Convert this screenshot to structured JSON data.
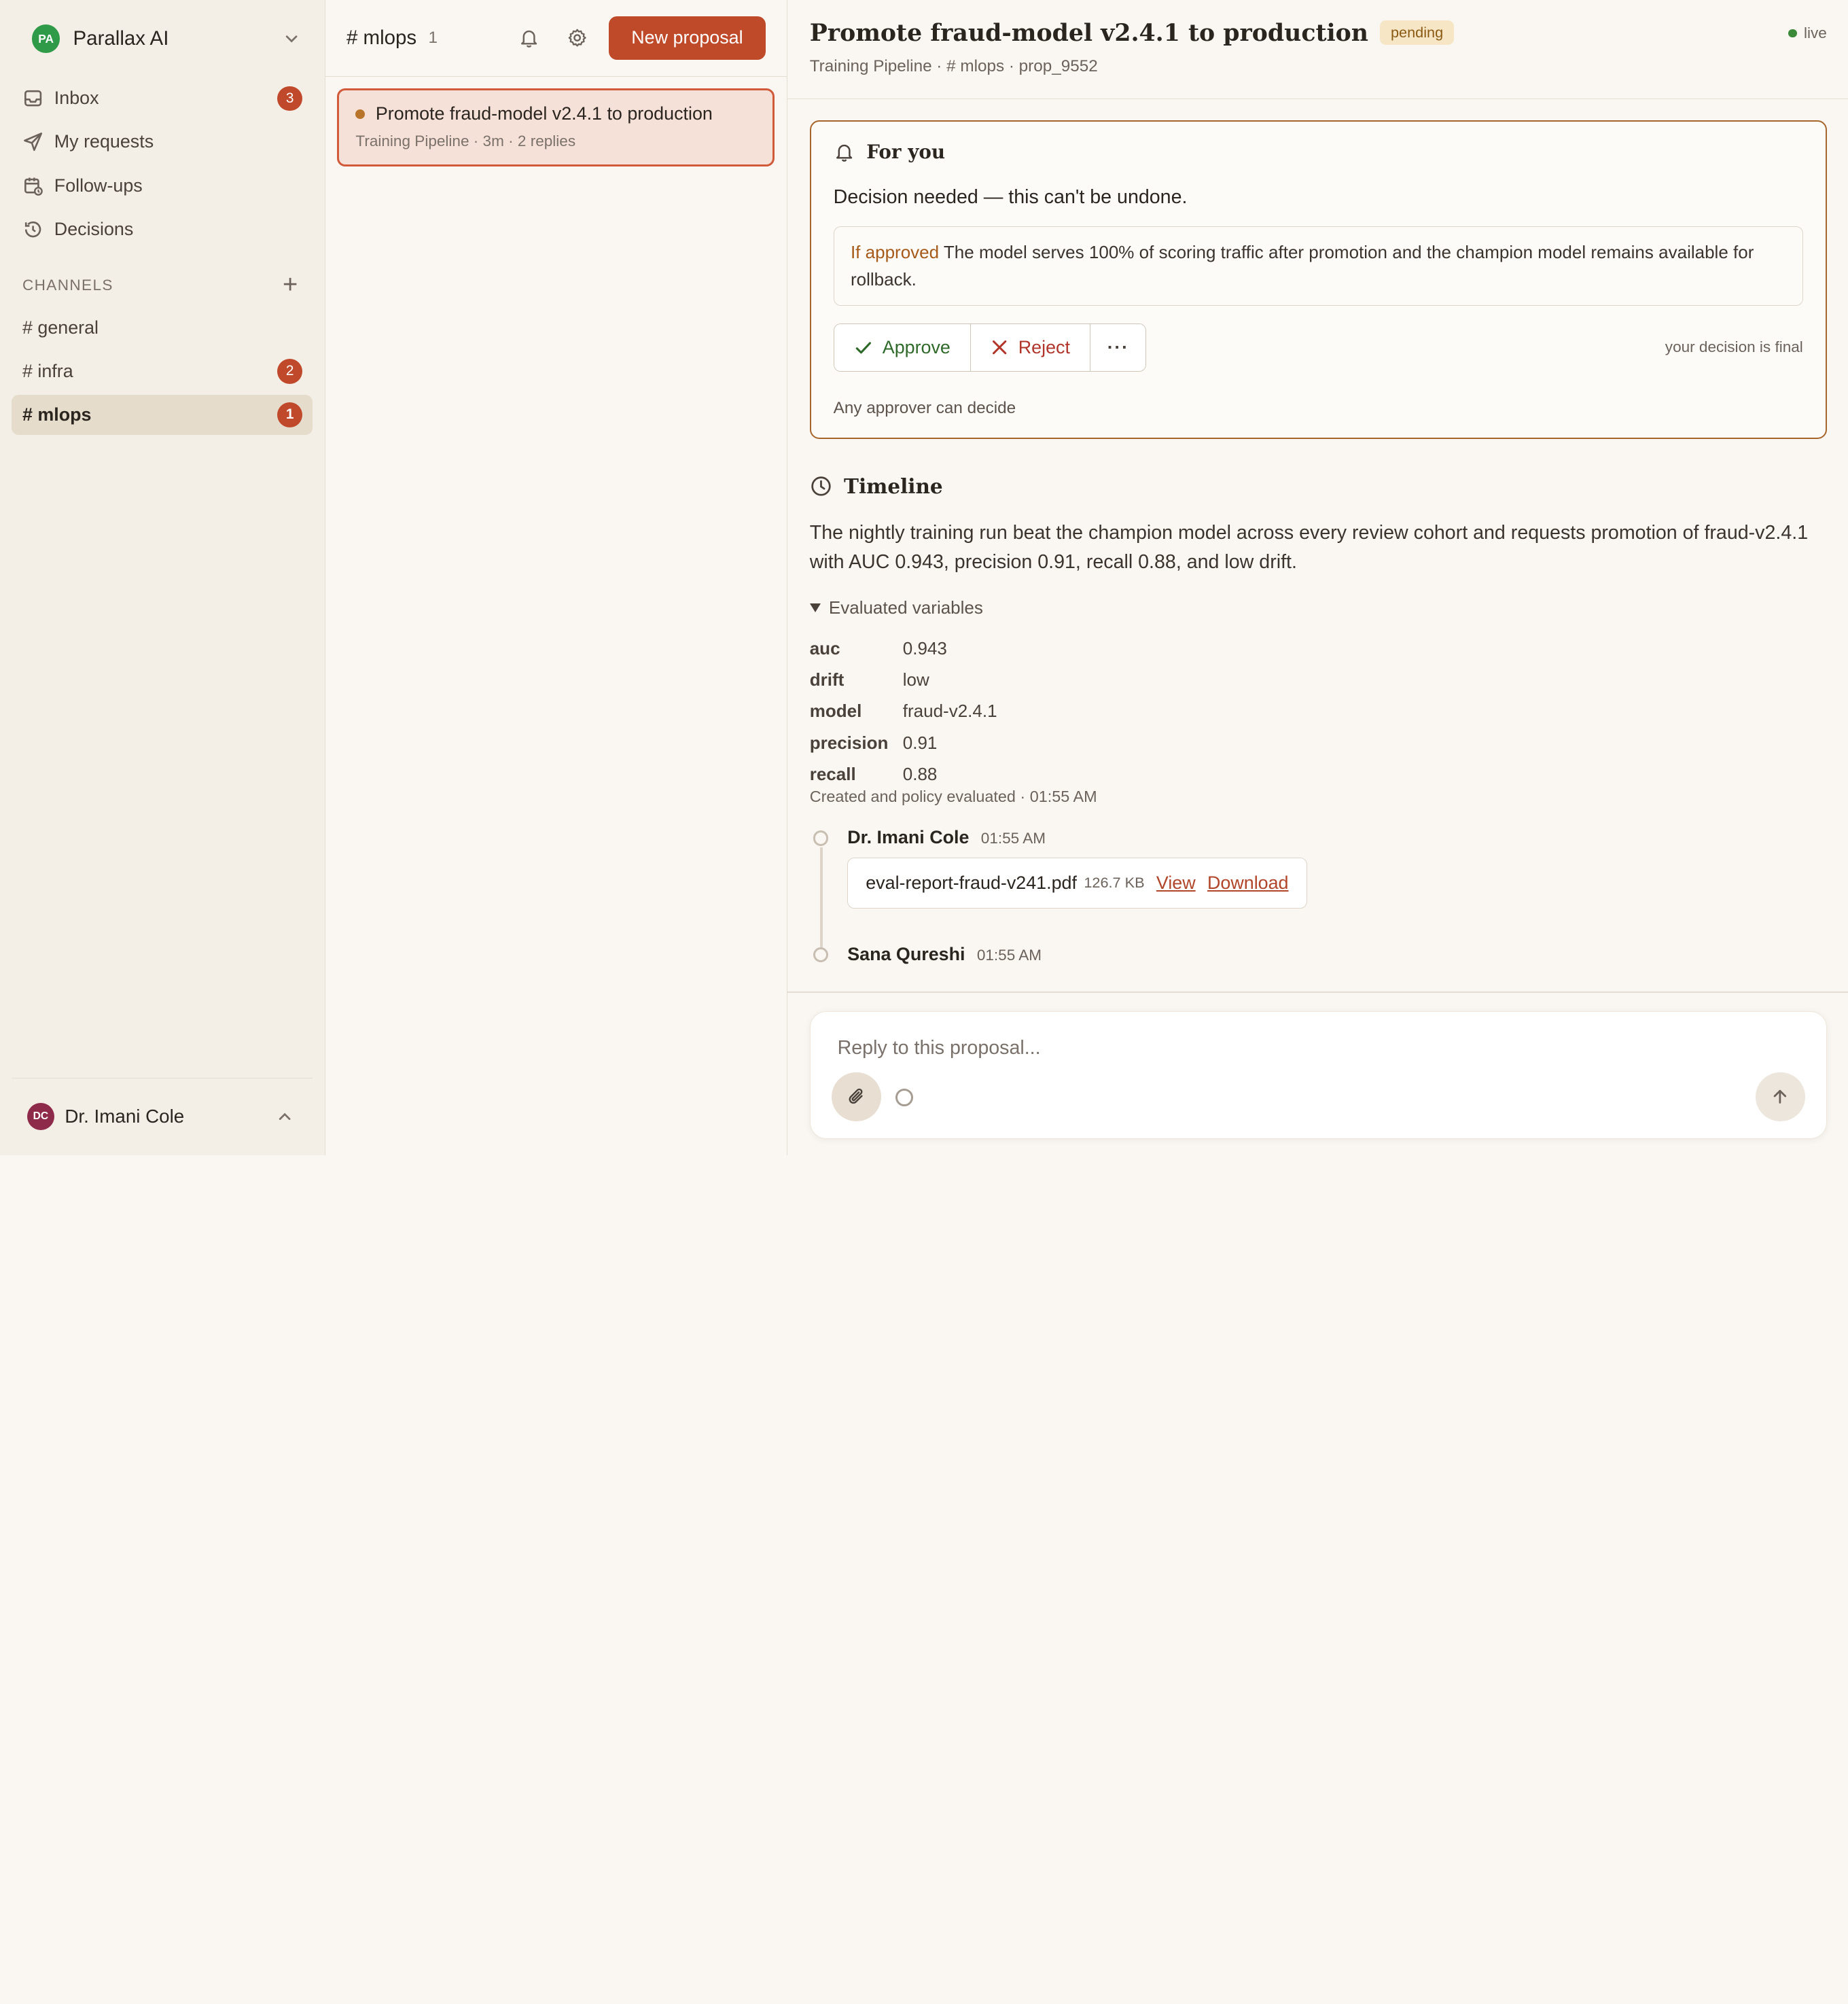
{
  "workspace": {
    "initials": "PA",
    "name": "Parallax AI"
  },
  "nav": [
    {
      "label": "Inbox",
      "icon": "inbox-icon",
      "badge": "3"
    },
    {
      "label": "My requests",
      "icon": "send-icon",
      "badge": ""
    },
    {
      "label": "Follow-ups",
      "icon": "calendar-clock-icon",
      "badge": ""
    },
    {
      "label": "Decisions",
      "icon": "history-icon",
      "badge": ""
    }
  ],
  "channels_header": "CHANNELS",
  "channels": [
    {
      "label": "# general",
      "badge": ""
    },
    {
      "label": "# infra",
      "badge": "2"
    },
    {
      "label": "# mlops",
      "badge": "1",
      "active": true
    }
  ],
  "user": {
    "initials": "DC",
    "name": "Dr. Imani Cole"
  },
  "list": {
    "title": "# mlops",
    "count": "1",
    "new_button": "New proposal",
    "items": [
      {
        "title": "Promote fraud-model v2.4.1 to production",
        "meta": "Training Pipeline · 3m · 2 replies"
      }
    ]
  },
  "detail": {
    "title": "Promote fraud-model v2.4.1 to production",
    "status": "pending",
    "live": "live",
    "subtitle": "Training Pipeline · # mlops · prop_9552",
    "for_you": {
      "heading": "For you",
      "decision": "Decision needed — this can't be undone.",
      "if_label": "If approved",
      "if_text": " The model serves 100% of scoring traffic after promotion and the champion model remains available for rollback.",
      "approve": "Approve",
      "reject": "Reject",
      "more": "···",
      "note": "your decision is final",
      "any": "Any approver can decide"
    },
    "timeline": {
      "heading": "Timeline",
      "description": "The nightly training run beat the champion model across every review cohort and requests promotion of fraud-v2.4.1 with AUC 0.943, precision 0.91, recall 0.88, and low drift.",
      "evaluated_label": "Evaluated variables",
      "variables": [
        {
          "key": "auc",
          "value": "0.943"
        },
        {
          "key": "drift",
          "value": "low"
        },
        {
          "key": "model",
          "value": "fraud-v2.4.1"
        },
        {
          "key": "precision",
          "value": "0.91"
        },
        {
          "key": "recall",
          "value": "0.88"
        }
      ],
      "created": "Created and policy evaluated · 01:55 AM",
      "events": [
        {
          "author": "Dr. Imani Cole",
          "time": "01:55 AM",
          "file": "eval-report-fraud-v241.pdf",
          "size": "126.7 KB",
          "view": "View",
          "download": "Download"
        },
        {
          "author": "Sana Qureshi",
          "time": "01:55 AM"
        }
      ]
    },
    "composer": {
      "placeholder": "Reply to this proposal..."
    }
  },
  "colors": {
    "accent": "#bf4a2a",
    "badge": "#c0492b",
    "approve": "#2f6a2a",
    "reject": "#b1352a",
    "live": "#3a8a3a"
  }
}
